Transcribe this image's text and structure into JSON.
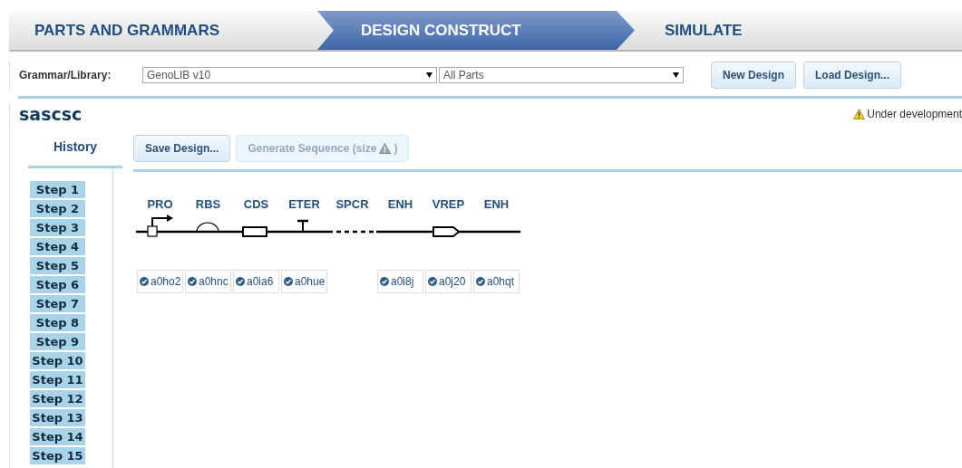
{
  "wizard_tabs": [
    {
      "label": "PARTS AND GRAMMARS",
      "selected": false
    },
    {
      "label": "DESIGN CONSTRUCT",
      "selected": true
    },
    {
      "label": "SIMULATE",
      "selected": false
    }
  ],
  "toolbar": {
    "grammar_label": "Grammar/Library:",
    "grammar_value": "GenoLIB v10",
    "parts_value": "All Parts",
    "buttons": [
      "New Design",
      "Load Design..."
    ]
  },
  "design": {
    "name": "sascsc",
    "notice": "Under development"
  },
  "history": {
    "title": "History",
    "steps": [
      "Step 1",
      "Step 2",
      "Step 3",
      "Step 4",
      "Step 5",
      "Step 6",
      "Step 7",
      "Step 8",
      "Step 9",
      "Step 10",
      "Step 11",
      "Step 12",
      "Step 13",
      "Step 14",
      "Step 15"
    ]
  },
  "actions": [
    {
      "label": "Save Design...",
      "disabled": false
    },
    {
      "label": "Generate Sequence (size",
      "suffix": ")",
      "disabled": true
    }
  ],
  "parts": [
    {
      "label": "PRO",
      "kind": "promoter",
      "part_id": "a0ho2"
    },
    {
      "label": "RBS",
      "kind": "rbs",
      "part_id": "a0hnc"
    },
    {
      "label": "CDS",
      "kind": "cds",
      "part_id": "a0ia6"
    },
    {
      "label": "ETER",
      "kind": "terminator",
      "part_id": "a0hue"
    },
    {
      "label": "SPCR",
      "kind": "spacer"
    },
    {
      "label": "ENH",
      "kind": "plain",
      "part_id": "a0i8j"
    },
    {
      "label": "VREP",
      "kind": "arrow",
      "part_id": "a0j20"
    },
    {
      "label": "ENH",
      "kind": "plain",
      "part_id": "a0hqt"
    }
  ]
}
